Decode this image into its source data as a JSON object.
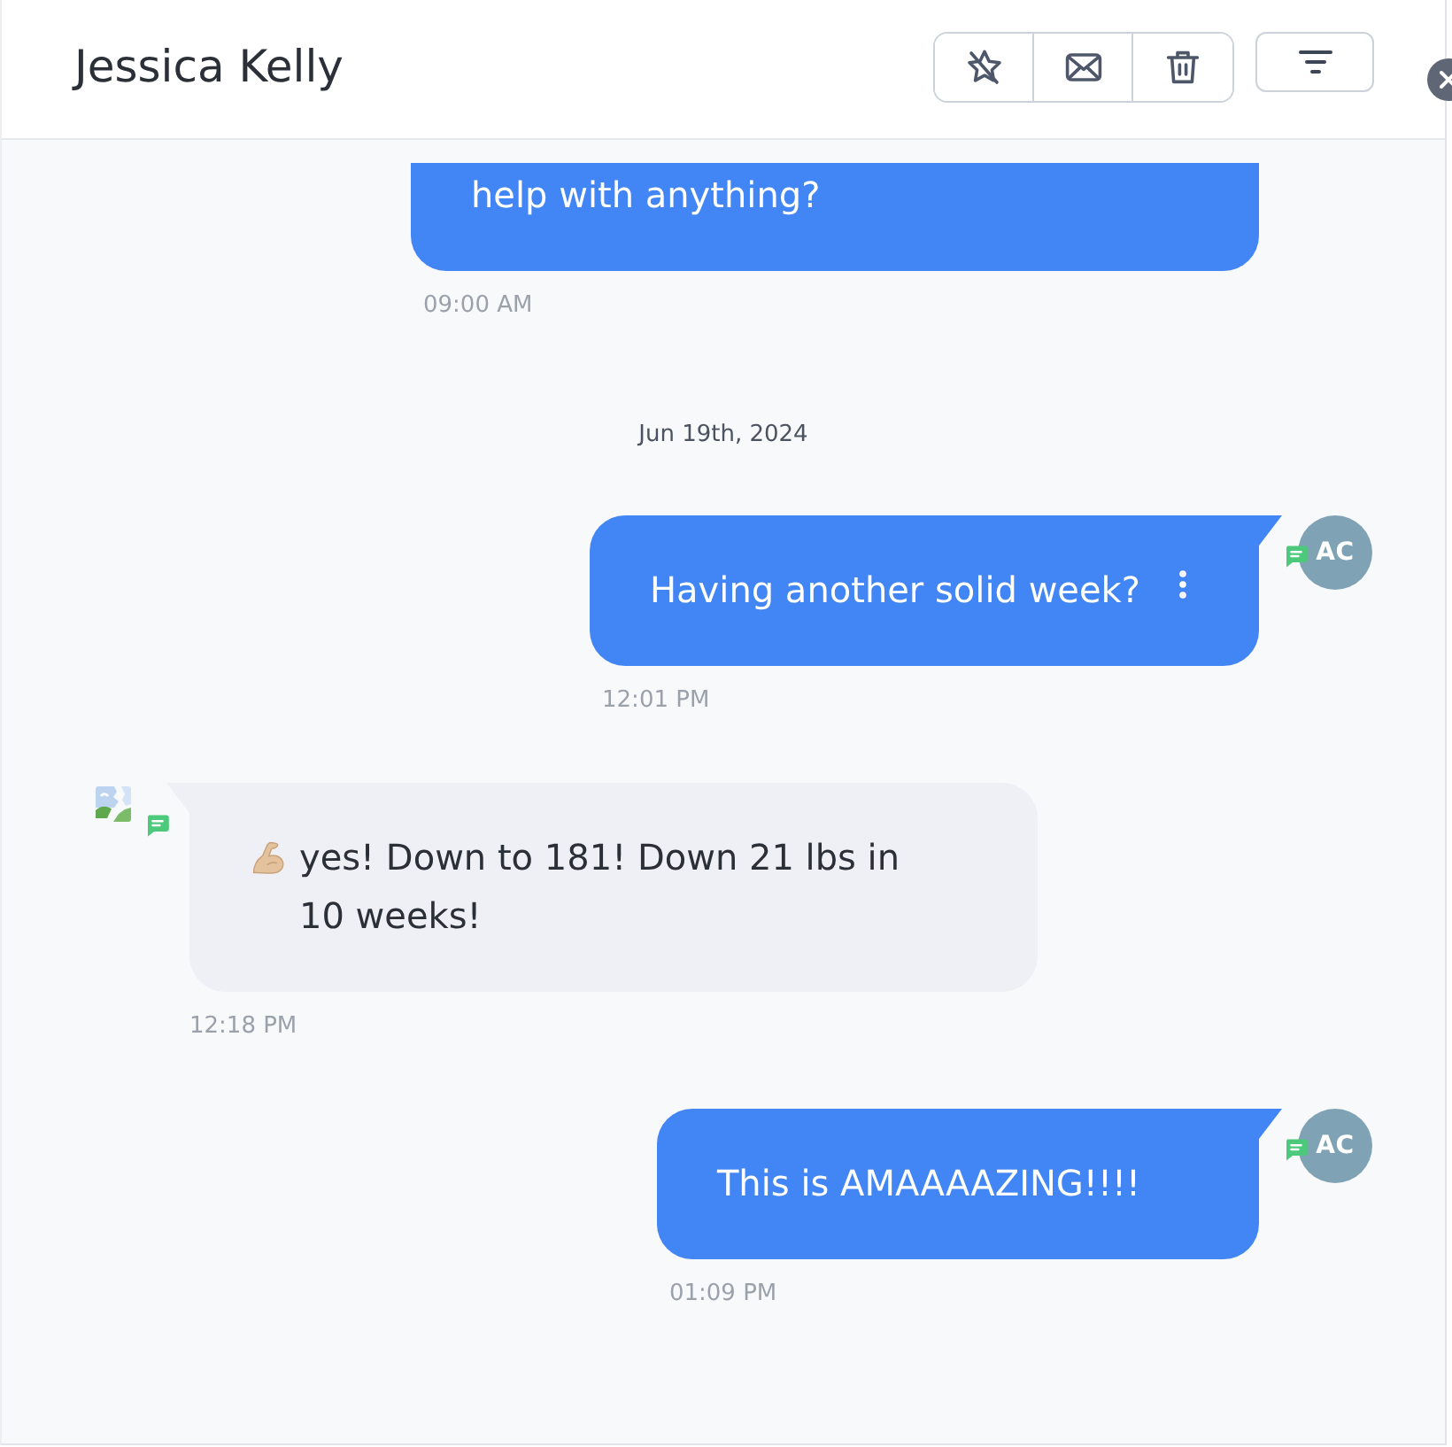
{
  "header": {
    "title": "Jessica Kelly"
  },
  "messages": [
    {
      "kind": "outgoing",
      "cropped": true,
      "text": "help with anything?",
      "time": "09:00 AM",
      "menu_visible": false
    },
    {
      "kind": "date",
      "text": "Jun 19th, 2024"
    },
    {
      "kind": "outgoing",
      "cropped": false,
      "text": "Having another solid week?",
      "time": "12:01 PM",
      "menu_visible": true,
      "avatar": {
        "kind": "initials",
        "text": "AC"
      }
    },
    {
      "kind": "incoming",
      "cropped": false,
      "leading_emoji": true,
      "text": "yes! Down to 181! Down 21 lbs in 10 weeks!",
      "time": "12:18 PM",
      "avatar": {
        "kind": "image"
      }
    },
    {
      "kind": "outgoing",
      "cropped": false,
      "text": "This is AMAAAAZING!!!!",
      "time": "01:09 PM",
      "menu_visible": false,
      "avatar": {
        "kind": "initials",
        "text": "AC"
      }
    }
  ]
}
